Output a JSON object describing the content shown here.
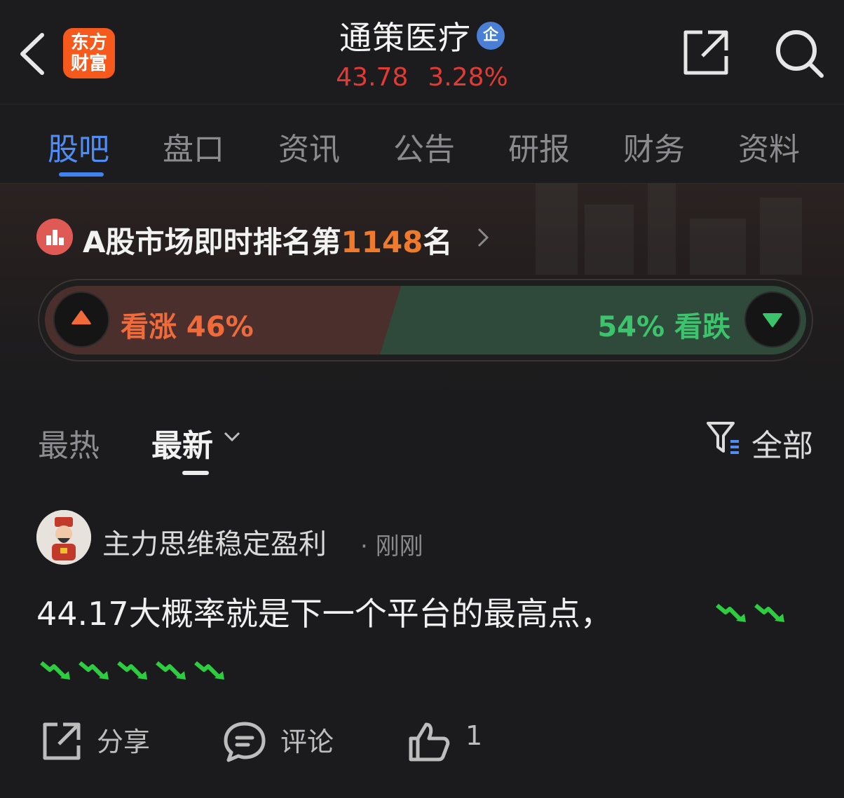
{
  "header": {
    "logo_line1": "东方",
    "logo_line2": "财富",
    "stock_name": "通策医疗",
    "badge": "企",
    "price": "43.78",
    "change_pct": "3.28%"
  },
  "tabs": [
    {
      "label": "股吧",
      "active": true
    },
    {
      "label": "盘口"
    },
    {
      "label": "资讯"
    },
    {
      "label": "公告"
    },
    {
      "label": "研报"
    },
    {
      "label": "财务"
    },
    {
      "label": "资料"
    }
  ],
  "ranking": {
    "prefix": "A股市场即时排名第",
    "rank": "1148",
    "suffix": "名"
  },
  "sentiment": {
    "bullish_label": "看涨 46%",
    "bearish_label": "54% 看跌",
    "bullish_pct": 46,
    "bearish_pct": 54,
    "bullish_color": "#f06a3a",
    "bearish_color": "#3cc46d"
  },
  "sort": {
    "hot": "最热",
    "latest": "最新",
    "filter": "全部"
  },
  "post": {
    "author": "主力思维稳定盈利",
    "time": "· 刚刚",
    "text": "44.17大概率就是下一个平台的最高点，",
    "emoji": "down-trend-icon",
    "emoji_count": 7,
    "share": "分享",
    "comment": "评论",
    "likes": "1"
  },
  "colors": {
    "accent": "#4f8df5",
    "price_red": "#e33a33",
    "rank_orange": "#f07a2c",
    "logo_orange": "#f55a1c"
  }
}
